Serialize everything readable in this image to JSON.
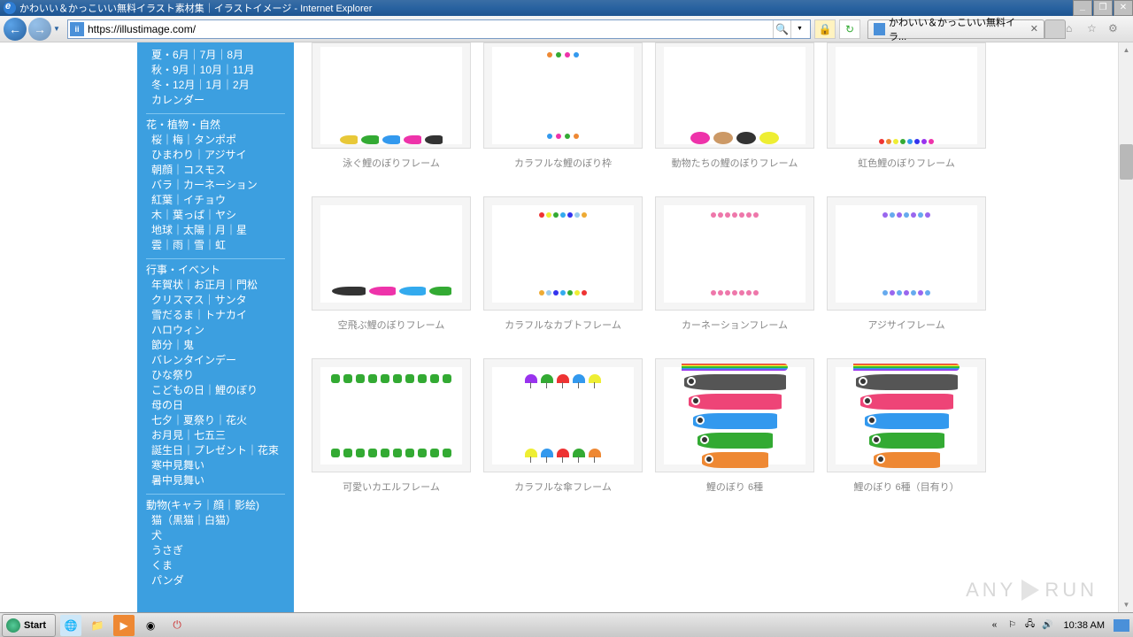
{
  "window_title": "かわいい＆かっこいい無料イラスト素材集｜イラストイメージ - Internet Explorer",
  "url": "https://illustimage.com/",
  "tab_title": "かわいい＆かっこいい無料イラ...",
  "sidebar": {
    "seasons": [
      "夏・6月｜7月｜8月",
      "秋・9月｜10月｜11月",
      "冬・12月｜1月｜2月",
      "カレンダー"
    ],
    "sections": [
      {
        "title": "花・植物・自然",
        "links": [
          "桜｜梅｜タンポポ",
          "ひまわり｜アジサイ",
          "朝顔｜コスモス",
          "バラ｜カーネーション",
          "紅葉｜イチョウ",
          "木｜葉っぱ｜ヤシ",
          "地球｜太陽｜月｜星",
          "雲｜雨｜雪｜虹"
        ]
      },
      {
        "title": "行事・イベント",
        "links": [
          "年賀状｜お正月｜門松",
          "クリスマス｜サンタ",
          "雪だるま｜トナカイ",
          "ハロウィン",
          "節分｜鬼",
          "バレンタインデー",
          "ひな祭り",
          "こどもの日｜鯉のぼり",
          "母の日",
          "七夕｜夏祭り｜花火",
          "お月見｜七五三",
          "誕生日｜プレゼント｜花束",
          "寒中見舞い",
          "暑中見舞い"
        ]
      },
      {
        "title": "動物(キャラ｜顔｜影絵)",
        "links": [
          "猫（黒猫｜白猫）",
          "犬",
          "うさぎ",
          "くま",
          "パンダ"
        ]
      }
    ]
  },
  "items": [
    {
      "caption": "泳ぐ鯉のぼりフレーム"
    },
    {
      "caption": "カラフルな鯉のぼり枠"
    },
    {
      "caption": "動物たちの鯉のぼりフレーム"
    },
    {
      "caption": "虹色鯉のぼりフレーム"
    },
    {
      "caption": "空飛ぶ鯉のぼりフレーム"
    },
    {
      "caption": "カラフルなカブトフレーム"
    },
    {
      "caption": "カーネーションフレーム"
    },
    {
      "caption": "アジサイフレーム"
    },
    {
      "caption": "可愛いカエルフレーム"
    },
    {
      "caption": "カラフルな傘フレーム"
    },
    {
      "caption": "鯉のぼり 6種"
    },
    {
      "caption": "鯉のぼり 6種（目有り）"
    }
  ],
  "clock": "10:38 AM",
  "start_label": "Start",
  "watermark": "ANY",
  "watermark2": "RUN"
}
